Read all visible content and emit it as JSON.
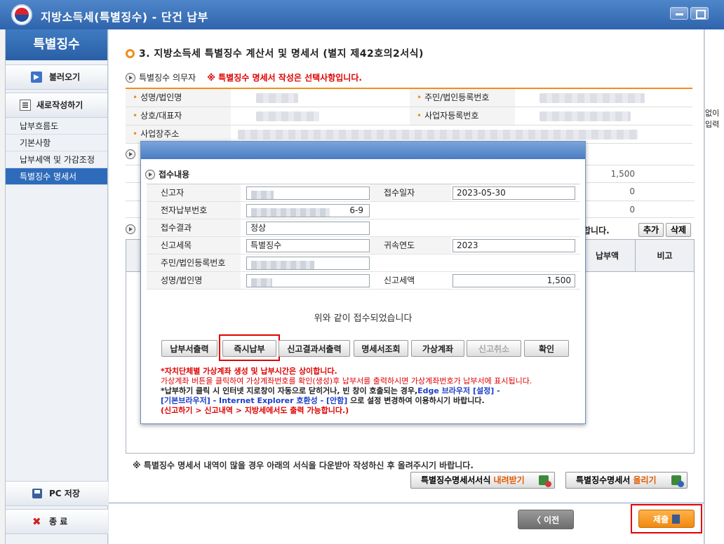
{
  "window": {
    "title": "지방소득세(특별징수) - 단건 납부"
  },
  "sidebar": {
    "title": "특별징수",
    "load_button": "불러오기",
    "new_button": "새로작성하기",
    "items": [
      {
        "label": "납부흐름도",
        "active": false
      },
      {
        "label": "기본사항",
        "active": false
      },
      {
        "label": "납부세액 및 가감조정",
        "active": false
      },
      {
        "label": "특별징수 명세서",
        "active": true
      }
    ],
    "pc_save": "PC 저장",
    "exit": "종 료"
  },
  "main": {
    "section_title": "3. 지방소득세 특별징수 계산서 및 명세서 (별지 제42호의2서식)",
    "obligor_title": "특별징수 의무자",
    "obligor_note": "※ 특별징수 명세서 작성은 선택사항입니다.",
    "fields": {
      "name_label": "성명/법인명",
      "resident_no_label": "주민/법인등록번호",
      "company_label": "상호/대표자",
      "business_no_label": "사업자등록번호",
      "address_label": "사업장주소"
    },
    "side_text": "없이 입력",
    "bg_values": [
      "1,500",
      "0",
      "0"
    ],
    "list_tail_text": "합니다.",
    "add_button": "추가",
    "delete_button": "삭제",
    "list_columns": [
      "납부액",
      "비고"
    ],
    "footnote": "※ 특별징수 명세서 내역이 많을 경우 아래의 서식을 다운받아 작성하신 후 올려주시기 바랍니다.",
    "download_button": {
      "text": "특별징수명세서서식 ",
      "highlight": "내려받기"
    },
    "upload_button": {
      "text": "특별징수명세서 ",
      "highlight": "올리기"
    },
    "prev_button": "〈 이전",
    "submit_button": "제출"
  },
  "modal": {
    "title": "접수내용",
    "rows": {
      "reporter_label": "신고자",
      "receipt_date_label": "접수일자",
      "receipt_date_value": "2023-05-30",
      "e_payment_no_label": "전자납부번호",
      "e_payment_no_suffix": "6-9",
      "result_label": "접수결과",
      "result_value": "정상",
      "tax_item_label": "신고세목",
      "tax_item_value": "특별징수",
      "year_label": "귀속연도",
      "year_value": "2023",
      "resident_no_label": "주민/법인등록번호",
      "name_label": "성명/법인명",
      "tax_amount_label": "신고세액",
      "tax_amount_value": "1,500"
    },
    "confirm_text": "위와 같이 접수되었습니다",
    "buttons": {
      "bill_print": "납부서출력",
      "pay_now": "즉시납부",
      "report_print": "신고결과서출력",
      "statement_view": "명세서조회",
      "virtual_account": "가상계좌",
      "cancel_report": "신고취소",
      "ok": "확인"
    },
    "notes": {
      "line1": "*자치단체별 가상계좌 생성 및 납부시간은 상이합니다.",
      "line2": "가상계좌 버튼을 클릭하여 가상계좌번호를 확인(생성)후 납부서를 출력하시면 가상계좌번호가 납부서에 표시됩니다.",
      "line3a": "*납부하기 클릭 시 인터넷 지로창이 자동으로 닫히거나, 빈 창이 호출되는 경우,",
      "line3b": "Edge 브라우저 [설정] -",
      "line4a": "[기본브라우저] - Internet Explorer 호환성 - [안함]",
      "line4b": " 으로 설정 변경하여 이용하시기 바랍니다.",
      "line5": "(신고하기 > 신고내역 > 지방세에서도 출력 가능합니다.)"
    }
  }
}
